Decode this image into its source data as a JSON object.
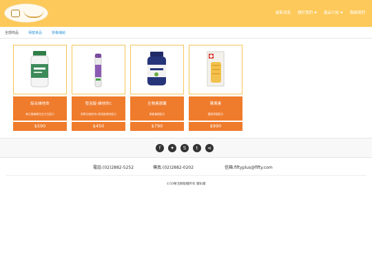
{
  "header": {
    "nav": [
      {
        "label": "最新消息",
        "dropdown": false
      },
      {
        "label": "關於我們",
        "dropdown": true
      },
      {
        "label": "產品介紹",
        "dropdown": true
      },
      {
        "label": "聯絡我們",
        "dropdown": false
      }
    ]
  },
  "tabs": [
    {
      "label": "全部商品",
      "style": "plain"
    },
    {
      "label": "保健食品",
      "style": "link"
    },
    {
      "label": "營養補給",
      "style": "link"
    }
  ],
  "products": [
    {
      "name": "綜合維他命",
      "desc": "每日營養補充全方位配方",
      "price": "$590",
      "image": "multivitamin-bottle-icon"
    },
    {
      "name": "發泡錠-維他命C",
      "desc": "高單位維他命C發泡錠補充配方",
      "price": "$450",
      "image": "effervescent-tube-icon"
    },
    {
      "name": "生物素膠囊",
      "desc": "美髮養顏配方",
      "price": "$790",
      "image": "biotin-bottle-icon"
    },
    {
      "name": "葉黃素",
      "desc": "護眼保健配方",
      "price": "$990",
      "image": "supplement-box-icon"
    }
  ],
  "social": [
    {
      "name": "facebook-icon",
      "glyph": "f"
    },
    {
      "name": "twitter-icon",
      "glyph": "✦"
    },
    {
      "name": "skype-icon",
      "glyph": "S"
    },
    {
      "name": "tumblr-icon",
      "glyph": "t"
    },
    {
      "name": "share-icon",
      "glyph": "⋖"
    }
  ],
  "contact": {
    "phone": "電話:(02)2882-5252",
    "fax": "傳真:(02)2882-0202",
    "email": "信箱:fiftyplus@fifty.com"
  },
  "footer": {
    "copyright": "©50樂活網版權所有 隱私權"
  },
  "colors": {
    "header": "#fdc95b",
    "accent": "#ef7b2c",
    "frame": "#f6c453",
    "link": "#3a9ad9"
  }
}
